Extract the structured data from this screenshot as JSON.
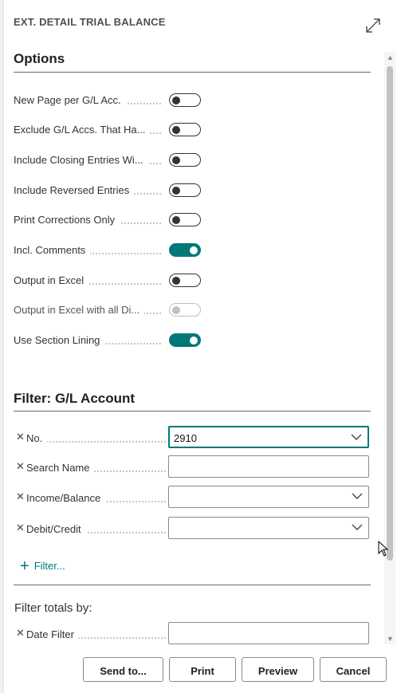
{
  "dialog": {
    "title": "EXT. DETAIL TRIAL BALANCE",
    "expand_icon": "expand-icon"
  },
  "options": {
    "title": "Options",
    "items": [
      {
        "label": "New Page per G/L Acc.",
        "state": "off"
      },
      {
        "label": "Exclude G/L Accs. That Ha...",
        "state": "off"
      },
      {
        "label": "Include Closing Entries Wi...",
        "state": "off"
      },
      {
        "label": "Include Reversed Entries",
        "state": "off"
      },
      {
        "label": "Print Corrections Only",
        "state": "off"
      },
      {
        "label": "Incl. Comments",
        "state": "on"
      },
      {
        "label": "Output in Excel",
        "state": "off"
      },
      {
        "label": "Output in Excel with all Di...",
        "state": "disabled"
      },
      {
        "label": "Use Section Lining",
        "state": "on"
      }
    ]
  },
  "filter": {
    "title": "Filter: G/L Account",
    "fields": [
      {
        "label": "No.",
        "value": "2910",
        "dropdown": true
      },
      {
        "label": "Search Name",
        "value": "",
        "dropdown": false
      },
      {
        "label": "Income/Balance",
        "value": "",
        "dropdown": true
      },
      {
        "label": "Debit/Credit",
        "value": "",
        "dropdown": true
      }
    ],
    "add_filter_label": "Filter..."
  },
  "totals": {
    "title": "Filter totals by:",
    "fields": [
      {
        "label": "Date Filter",
        "value": ""
      }
    ]
  },
  "footer": {
    "send_to": "Send to...",
    "print": "Print",
    "preview": "Preview",
    "cancel": "Cancel"
  },
  "colors": {
    "accent": "#00787a",
    "toggle_off": "#333333",
    "disabled": "#c0c0c0"
  }
}
